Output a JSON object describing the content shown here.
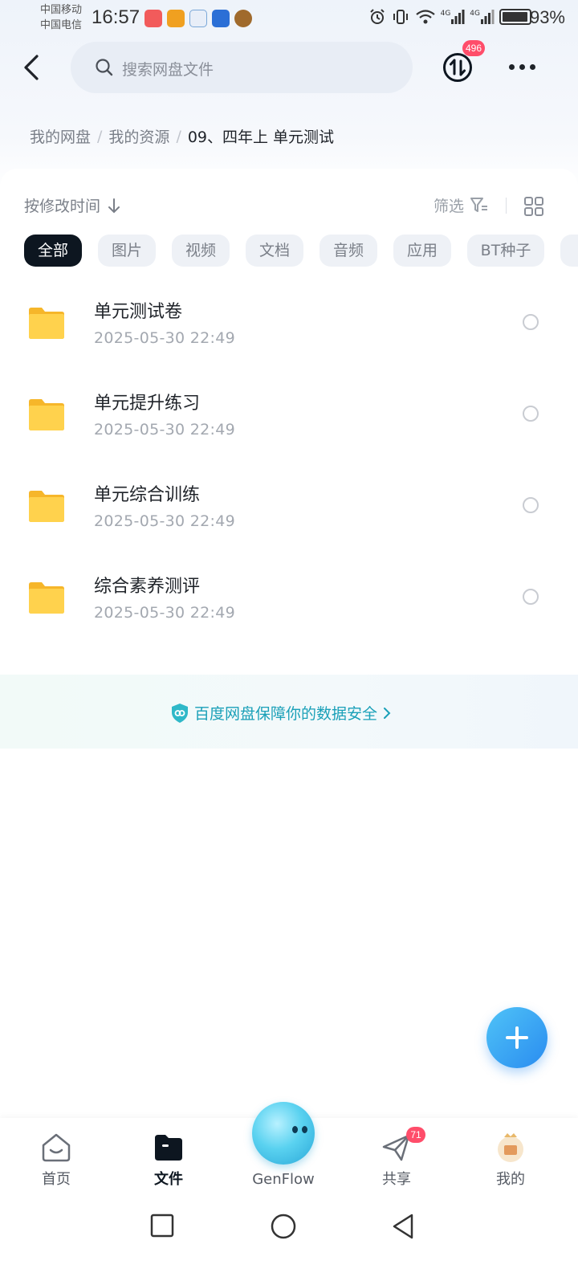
{
  "status_bar": {
    "carrier_1": "中国移动",
    "carrier_2": "中国电信",
    "time": "16:57",
    "network_1": "4G",
    "network_2": "4G",
    "battery": "93%"
  },
  "header": {
    "search_placeholder": "搜索网盘文件",
    "transfer_badge": "496"
  },
  "breadcrumb": {
    "items": [
      "我的网盘",
      "我的资源"
    ],
    "current": "09、四年上 单元测试"
  },
  "toolbar": {
    "sort_label": "按修改时间",
    "filter_label": "筛选"
  },
  "tabs": [
    {
      "label": "全部",
      "active": true
    },
    {
      "label": "图片",
      "active": false
    },
    {
      "label": "视频",
      "active": false
    },
    {
      "label": "文档",
      "active": false
    },
    {
      "label": "音频",
      "active": false
    },
    {
      "label": "应用",
      "active": false
    },
    {
      "label": "BT种子",
      "active": false
    }
  ],
  "files": [
    {
      "name": "单元测试卷",
      "date": "2025-05-30  22:49",
      "type": "folder"
    },
    {
      "name": "单元提升练习",
      "date": "2025-05-30  22:49",
      "type": "folder"
    },
    {
      "name": "单元综合训练",
      "date": "2025-05-30  22:49",
      "type": "folder"
    },
    {
      "name": "综合素养测评",
      "date": "2025-05-30  22:49",
      "type": "folder"
    }
  ],
  "safety_banner": {
    "text": "百度网盘保障你的数据安全"
  },
  "bottom_nav": {
    "home": "首页",
    "files": "文件",
    "genflow": "GenFlow",
    "share": "共享",
    "share_badge": "71",
    "mine": "我的"
  },
  "colors": {
    "accent_blue": "#2a8cf0",
    "badge_red": "#ff4d6a",
    "folder_yellow": "#ffc83d",
    "safety_teal": "#1aa0b8"
  }
}
